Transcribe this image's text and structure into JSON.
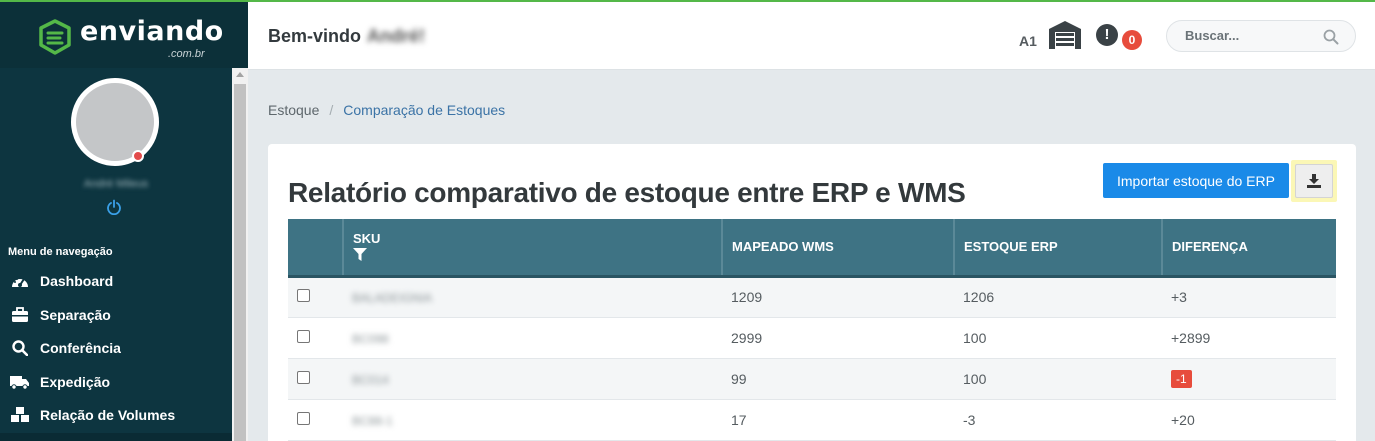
{
  "colors": {
    "sidebar_bg": "#0d3540",
    "brand_green": "#54b848",
    "table_header": "#3e7384",
    "primary_button": "#1a8ae8",
    "danger": "#e74c3c",
    "link": "#3b73a6"
  },
  "brand": {
    "name": "enviando",
    "domain": ".com.br"
  },
  "user": {
    "name": "André Mileus",
    "power_icon": "power-icon"
  },
  "sidebar": {
    "nav_title": "Menu de navegação",
    "items": [
      {
        "label": "Dashboard",
        "icon": "gauge-icon"
      },
      {
        "label": "Separação",
        "icon": "briefcase-icon"
      },
      {
        "label": "Conferência",
        "icon": "search-icon"
      },
      {
        "label": "Expedição",
        "icon": "truck-icon"
      },
      {
        "label": "Relação de Volumes",
        "icon": "cubes-icon"
      }
    ]
  },
  "header": {
    "welcome": "Bem-vindo",
    "welcome_name": "André!",
    "unit": "A1",
    "notification_count": "0",
    "alert_symbol": "!",
    "search_placeholder": "Buscar..."
  },
  "breadcrumb": {
    "root": "Estoque",
    "separator": "/",
    "current": "Comparação de Estoques"
  },
  "main": {
    "title": "Relatório comparativo de estoque entre ERP e WMS",
    "import_button": "Importar estoque do ERP",
    "download_icon": "download-icon"
  },
  "table": {
    "columns": {
      "sku": "SKU",
      "wms": "MAPEADO WMS",
      "erp": "ESTOQUE ERP",
      "diff": "DIFERENÇA"
    },
    "rows": [
      {
        "sku": "BALADEIGNIA",
        "wms": "1209",
        "erp": "1206",
        "diff": "+3",
        "negative": false
      },
      {
        "sku": "BC098",
        "wms": "2999",
        "erp": "100",
        "diff": "+2899",
        "negative": false
      },
      {
        "sku": "BC014",
        "wms": "99",
        "erp": "100",
        "diff": "-1",
        "negative": true
      },
      {
        "sku": "BC88-1",
        "wms": "17",
        "erp": "-3",
        "diff": "+20",
        "negative": false
      }
    ]
  }
}
